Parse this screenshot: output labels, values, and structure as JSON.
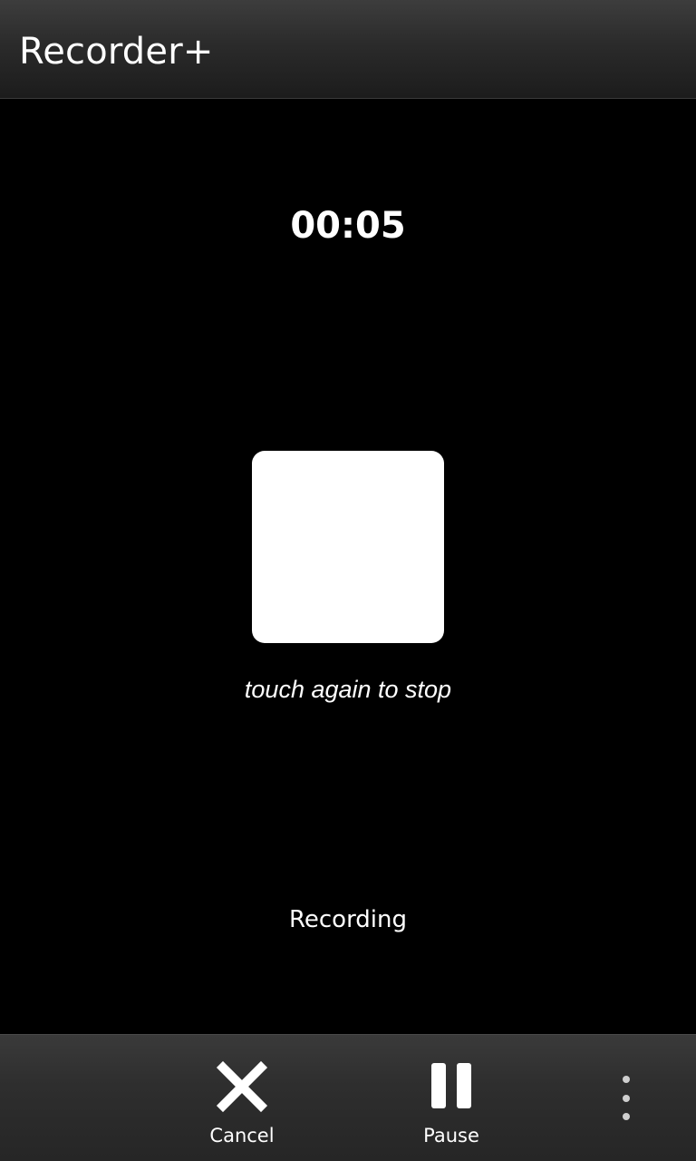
{
  "app": {
    "title": "Recorder+"
  },
  "recorder": {
    "elapsed_time": "00:05",
    "hint": "touch again to stop",
    "status": "Recording"
  },
  "action_bar": {
    "cancel_label": "Cancel",
    "cancel_icon": "close-icon",
    "pause_label": "Pause",
    "pause_icon": "pause-icon",
    "overflow_icon": "overflow-menu-icon"
  },
  "colors": {
    "background": "#000000",
    "text": "#ffffff",
    "stop_button": "#ffffff",
    "bar": "#2e2e2e"
  }
}
